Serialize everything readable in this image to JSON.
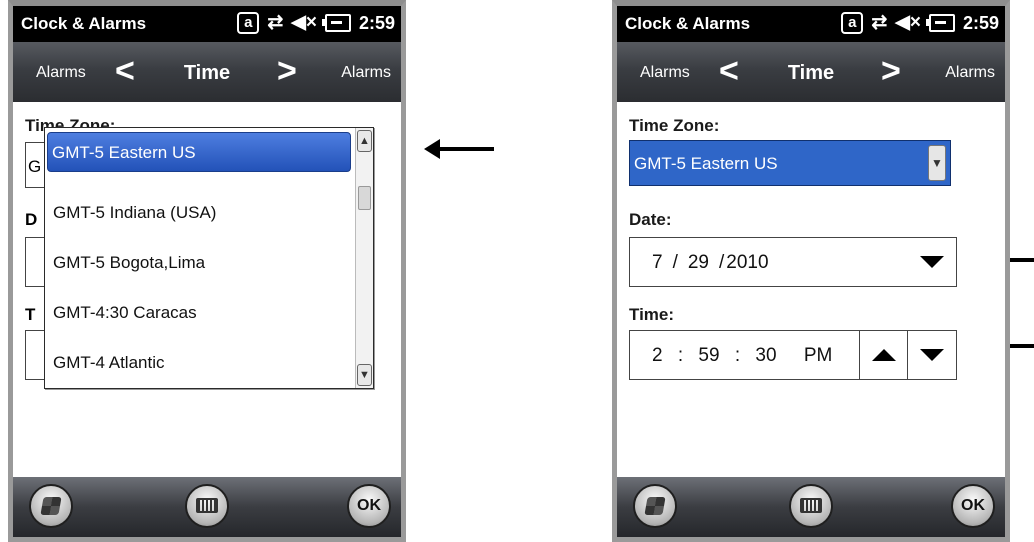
{
  "status_bar": {
    "title": "Clock & Alarms",
    "time": "2:59"
  },
  "nav": {
    "prev_label": "Alarms",
    "title": "Time",
    "next_label": "Alarms"
  },
  "labels": {
    "time_zone": "Time Zone:",
    "date": "Date:",
    "time": "Time:"
  },
  "time_zone": {
    "value": "GMT-5 Eastern US"
  },
  "date": {
    "month": "7",
    "day": "29",
    "year": "2010"
  },
  "time": {
    "hour": "2",
    "minute": "59",
    "second": "30",
    "ampm": "PM"
  },
  "dropdown": {
    "items": [
      "GMT-5 Eastern US",
      "GMT-5 Indiana (USA)",
      "GMT-5 Bogota,Lima",
      "GMT-4:30 Caracas",
      "GMT-4 Atlantic"
    ]
  },
  "left_obscured": {
    "tz_char": "G",
    "date_char": "D",
    "time_char": "T"
  },
  "taskbar": {
    "ok_label": "OK"
  },
  "icons": [
    "windows-start-icon",
    "keyboard-icon",
    "at-icon",
    "sync-icon",
    "speaker-mute-icon",
    "battery-icon",
    "chevron-left-icon",
    "chevron-right-icon",
    "dropdown-arrow-icon",
    "scroll-up-icon",
    "scroll-down-icon"
  ],
  "colors": {
    "selection_blue": "#2f66c8",
    "statusbar": "#000000"
  }
}
